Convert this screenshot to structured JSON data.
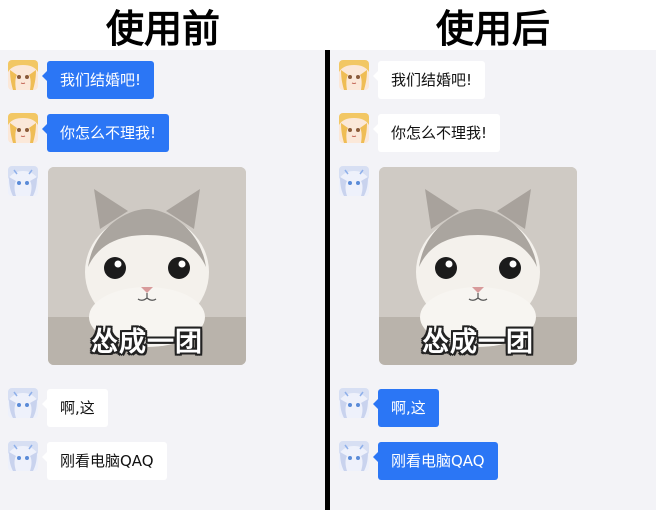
{
  "headers": {
    "before": "使用前",
    "after": "使用后"
  },
  "avatars": {
    "girl_blonde": "blonde-girl-avatar-icon",
    "girl_silver": "silver-hair-girl-avatar-icon"
  },
  "colors": {
    "blue_bubble": "#2b76f5",
    "white_bubble": "#ffffff",
    "panel_bg": "#f3f3f7",
    "divider": "#000000"
  },
  "before": {
    "messages": [
      {
        "text": "我们结婚吧!",
        "style": "blue",
        "avatar": "girl_blonde"
      },
      {
        "text": "你怎么不理我!",
        "style": "blue",
        "avatar": "girl_blonde"
      },
      {
        "sticker_caption": "怂成一团",
        "avatar": "girl_silver"
      },
      {
        "text": "啊,这",
        "style": "white",
        "avatar": "girl_silver"
      },
      {
        "text": "刚看电脑QAQ",
        "style": "white",
        "avatar": "girl_silver"
      }
    ]
  },
  "after": {
    "messages": [
      {
        "text": "我们结婚吧!",
        "style": "white",
        "avatar": "girl_blonde"
      },
      {
        "text": "你怎么不理我!",
        "style": "white",
        "avatar": "girl_blonde"
      },
      {
        "sticker_caption": "怂成一团",
        "avatar": "girl_silver"
      },
      {
        "text": "啊,这",
        "style": "blue",
        "avatar": "girl_silver"
      },
      {
        "text": "刚看电脑QAQ",
        "style": "blue",
        "avatar": "girl_silver"
      }
    ]
  }
}
